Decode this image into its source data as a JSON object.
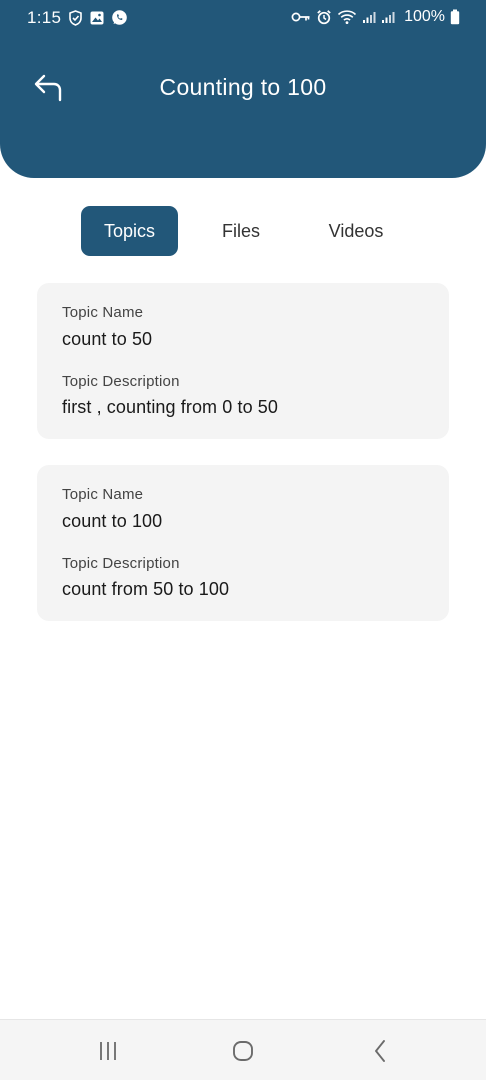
{
  "status_bar": {
    "time": "1:15",
    "battery": "100%",
    "left_icons": [
      "shield-icon",
      "gallery-icon",
      "whatsapp-icon"
    ],
    "right_icons": [
      "key-icon",
      "alarm-icon",
      "wifi-icon",
      "signal-icon",
      "signal-icon",
      "battery-icon"
    ]
  },
  "header": {
    "title": "Counting to 100",
    "back_icon": "back-arrow-icon",
    "color": "#225779"
  },
  "tabs": [
    {
      "label": "Topics",
      "active": true
    },
    {
      "label": "Files",
      "active": false
    },
    {
      "label": "Videos",
      "active": false
    }
  ],
  "topics": [
    {
      "name_label": "Topic Name",
      "name": "count to 50",
      "description_label": "Topic Description",
      "description": "first , counting from 0 to 50"
    },
    {
      "name_label": "Topic Name",
      "name": "count to 100",
      "description_label": "Topic Description",
      "description": "count from 50 to 100"
    }
  ],
  "nav_bar": {
    "icons": [
      "recent-apps-icon",
      "home-icon",
      "back-icon"
    ]
  }
}
